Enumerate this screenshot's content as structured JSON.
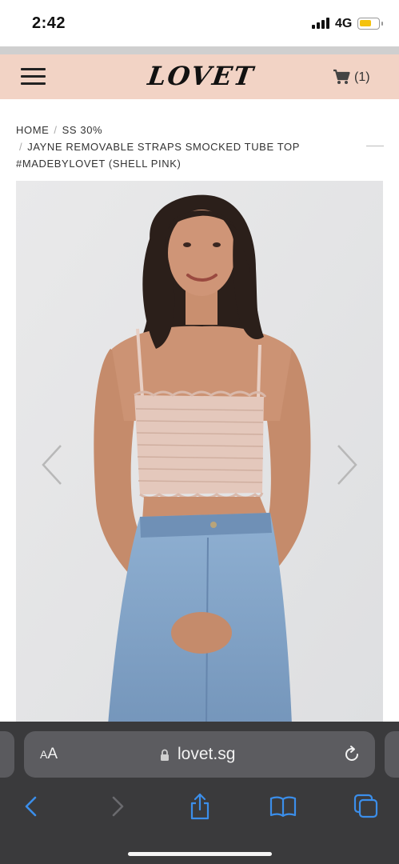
{
  "status_bar": {
    "time": "2:42",
    "network": "4G",
    "battery_level": 0.65,
    "battery_color": "#f4c20d"
  },
  "header": {
    "background_color": "#f2d3c5",
    "logo_text": "LOVET",
    "menu_icon": "hamburger-menu-icon",
    "cart_icon": "shopping-cart-icon",
    "cart_count": "(1)"
  },
  "breadcrumb": {
    "home": "HOME",
    "category": "SS 30%",
    "separator": "/",
    "product": "JAYNE REMOVABLE STRAPS SMOCKED TUBE TOP #MADEBYLOVET (SHELL PINK)"
  },
  "product_gallery": {
    "prev_icon": "chevron-left-icon",
    "next_icon": "chevron-right-icon",
    "image_subject": "product-photo"
  },
  "browser": {
    "text_size_label_small": "A",
    "text_size_label_large": "A",
    "url": "lovet.sg",
    "lock_icon": "lock-icon",
    "reload_icon": "reload-icon",
    "toolbar_icons": [
      "back-icon",
      "forward-icon",
      "share-icon",
      "bookmarks-icon",
      "tabs-icon"
    ],
    "accent_color": "#3b8eea"
  }
}
